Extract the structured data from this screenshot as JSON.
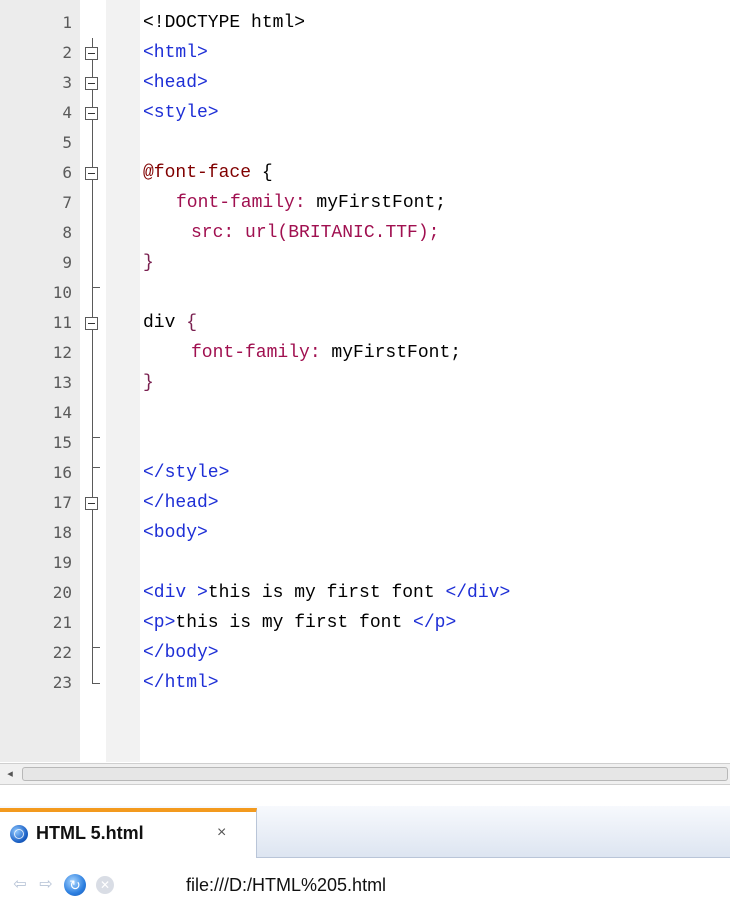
{
  "editor": {
    "line_numbers": [
      "1",
      "2",
      "3",
      "4",
      "5",
      "6",
      "7",
      "8",
      "9",
      "10",
      "11",
      "12",
      "13",
      "14",
      "15",
      "16",
      "17",
      "18",
      "19",
      "20",
      "21",
      "22",
      "23"
    ],
    "lines": {
      "l1": "<!DOCTYPE html>",
      "l2": "<html>",
      "l3": "<head>",
      "l4": "<style>",
      "l6_at": "@font-face",
      "l6_brace": " {",
      "l7_prop": "font-family:",
      "l7_val": " myFirstFont;",
      "l8_prop": "src:",
      "l8_val": " url(BRITANIC.TTF);",
      "l9": "}",
      "l11_sel": "div",
      "l11_brace": " {",
      "l12_prop": "font-family:",
      "l12_val": " myFirstFont;",
      "l13": "}",
      "l15": "</style>",
      "l16": "</head>",
      "l17": "<body>",
      "l19_open": "<div >",
      "l19_text": "this is my first font ",
      "l19_close": "</div>",
      "l20_open": "<p>",
      "l20_text": "this is my first font ",
      "l20_close": "</p>",
      "l21": "</body>",
      "l22": "</html>"
    }
  },
  "scrollbar": {
    "left_arrow": "◂"
  },
  "tabs": [
    {
      "title": "HTML 5.html",
      "close": "×"
    }
  ],
  "navigation": {
    "back_icon": "back-arrow-icon",
    "forward_icon": "forward-arrow-icon",
    "reload_icon": "reload-icon",
    "stop_icon": "stop-icon",
    "address": "file:///D:/HTML%205.html"
  },
  "colors": {
    "tag": "#1e2fd6",
    "at_rule": "#800000",
    "property": "#a01050",
    "tab_accent": "#f39a1e"
  }
}
